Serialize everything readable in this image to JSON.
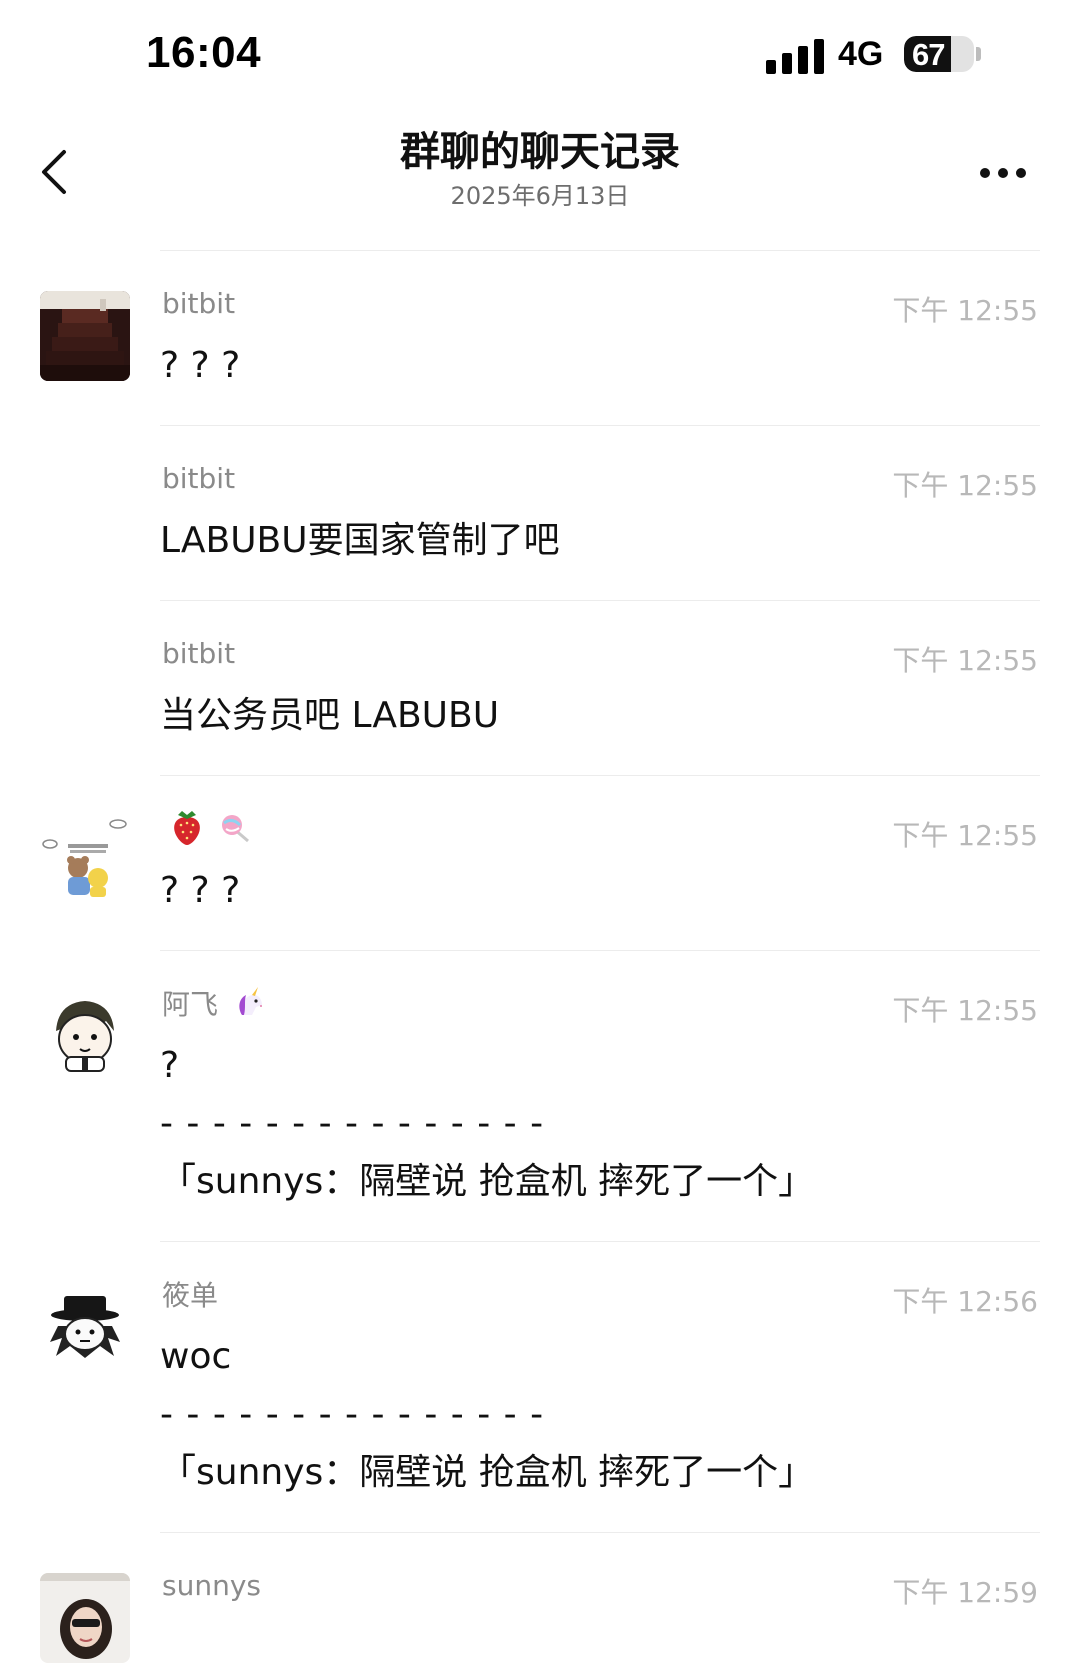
{
  "status_bar": {
    "time": "16:04",
    "network": "4G",
    "battery": "67",
    "battery_level": 0.67,
    "signal_bars": 4
  },
  "nav": {
    "title": "群聊的聊天记录",
    "subtitle": "2025年6月13日",
    "back_icon": "chevron-left-icon",
    "more_icon": "more-dots-icon"
  },
  "messages": [
    {
      "sender": "bitbit",
      "time": "下午 12:55",
      "lines": [
        "? ? ?"
      ],
      "show_avatar": true,
      "avatar": "staircase-photo"
    },
    {
      "sender": "bitbit",
      "time": "下午 12:55",
      "lines": [
        "LABUBU要国家管制了吧"
      ],
      "show_avatar": false
    },
    {
      "sender": "bitbit",
      "time": "下午 12:55",
      "lines": [
        "当公务员吧 LABUBU"
      ],
      "show_avatar": false
    },
    {
      "sender": "",
      "sender_icons": [
        "strawberry-icon",
        "lollipop-icon"
      ],
      "time": "下午 12:55",
      "lines": [
        "? ? ?"
      ],
      "show_avatar": true,
      "avatar": "cartoon-bear-sticker"
    },
    {
      "sender": "阿飞",
      "sender_icons": [
        "unicorn-icon"
      ],
      "time": "下午 12:55",
      "lines": [
        "?",
        "- - - - - - - - - - - - - - -",
        "「sunnys：隔壁说 抢盒机 摔死了一个」"
      ],
      "show_avatar": true,
      "avatar": "cartoon-boy-sketch"
    },
    {
      "sender": "筱单",
      "time": "下午 12:56",
      "lines": [
        "woc",
        "- - - - - - - - - - - - - - -",
        "「sunnys：隔壁说 抢盒机 摔死了一个」"
      ],
      "show_avatar": true,
      "avatar": "hat-character-sketch"
    },
    {
      "sender": "sunnys",
      "time": "下午 12:59",
      "lines": [],
      "show_avatar": true,
      "avatar": "girl-photo"
    }
  ]
}
